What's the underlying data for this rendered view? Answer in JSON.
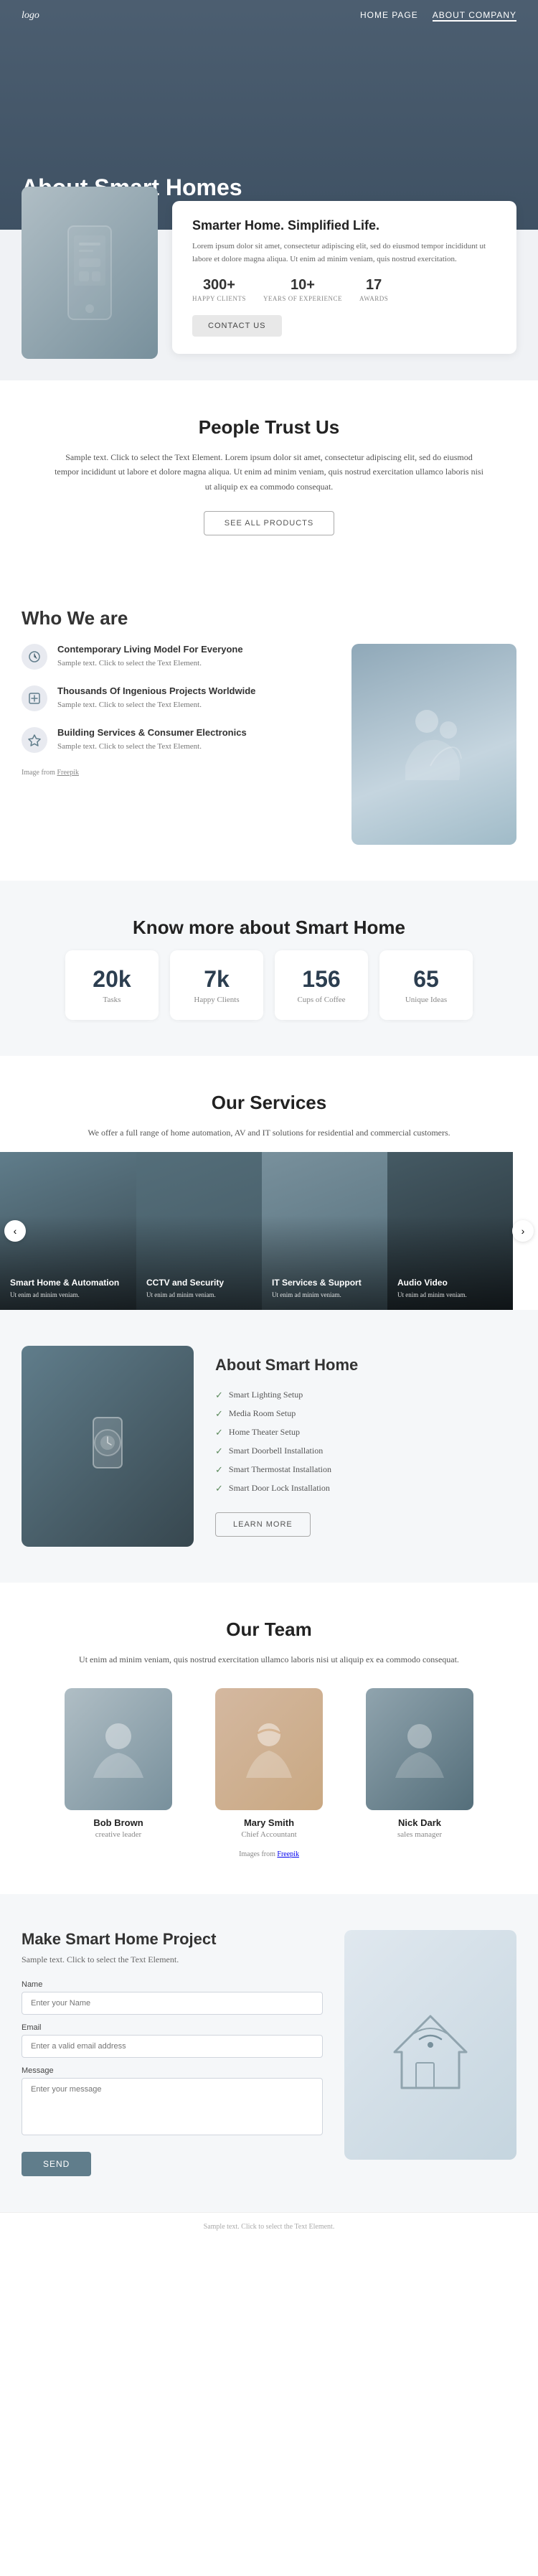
{
  "nav": {
    "logo": "logo",
    "links": [
      {
        "label": "HOME PAGE",
        "active": false
      },
      {
        "label": "ABOUT COMPANY",
        "active": true
      }
    ]
  },
  "hero": {
    "title": "About Smart Homes"
  },
  "hero_card": {
    "tagline": "Smarter Home. Simplified Life.",
    "description": "Lorem ipsum dolor sit amet, consectetur adipiscing elit, sed do eiusmod tempor incididunt ut labore et dolore magna aliqua. Ut enim ad minim veniam, quis nostrud exercitation.",
    "stats": [
      {
        "number": "300+",
        "label": "HAPPY CLIENTS"
      },
      {
        "number": "10+",
        "label": "YEARS OF EXPERIENCE"
      },
      {
        "number": "17",
        "label": "AWARDS"
      }
    ],
    "contact_button": "CONTACT US"
  },
  "people_trust": {
    "title": "People Trust Us",
    "text": "Sample text. Click to select the Text Element. Lorem ipsum dolor sit amet, consectetur adipiscing elit, sed do eiusmod tempor incididunt ut labore et dolore magna aliqua. Ut enim ad minim veniam, quis nostrud exercitation ullamco laboris nisi ut aliquip ex ea commodo consequat.",
    "button": "SEE ALL PRODUCTS"
  },
  "who_we_are": {
    "title": "Who We are",
    "items": [
      {
        "icon": "1",
        "title": "Contemporary Living Model For Everyone",
        "text": "Sample text. Click to select the Text Element."
      },
      {
        "icon": "2",
        "title": "Thousands Of Ingenious Projects Worldwide",
        "text": "Sample text. Click to select the Text Element."
      },
      {
        "icon": "3",
        "title": "Building Services & Consumer Electronics",
        "text": "Sample text. Click to select the Text Element."
      }
    ],
    "freepik_label": "Image from ",
    "freepik_link": "Freepik"
  },
  "know_more": {
    "title": "Know more about Smart Home",
    "stats": [
      {
        "number": "20k",
        "label": "Tasks"
      },
      {
        "number": "7k",
        "label": "Happy Clients"
      },
      {
        "number": "156",
        "label": "Cups of Coffee"
      },
      {
        "number": "65",
        "label": "Unique Ideas"
      }
    ]
  },
  "our_services": {
    "title": "Our Services",
    "text": "We offer a full range of home automation, AV and IT solutions for residential and commercial customers.",
    "cards": [
      {
        "title": "Smart Home & Automation",
        "text": "Ut enim ad minim veniam."
      },
      {
        "title": "CCTV and Security",
        "text": "Ut enim ad minim veniam."
      },
      {
        "title": "IT Services & Support",
        "text": "Ut enim ad minim veniam."
      },
      {
        "title": "Audio Video",
        "text": "Ut enim ad minim veniam."
      }
    ]
  },
  "about_smart": {
    "title": "About Smart Home",
    "list": [
      "Smart Lighting Setup",
      "Media Room Setup",
      "Home Theater Setup",
      "Smart Doorbell Installation",
      "Smart Thermostat Installation",
      "Smart Door Lock Installation"
    ],
    "button": "LEARN MORE"
  },
  "our_team": {
    "title": "Our Team",
    "text": "Ut enim ad minim veniam, quis nostrud exercitation ullamco laboris nisi ut aliquip ex ea commodo consequat.",
    "members": [
      {
        "name": "Bob Brown",
        "role": "creative leader",
        "photo_class": "brown"
      },
      {
        "name": "Mary Smith",
        "role": "Chief Accountant",
        "photo_class": "smith"
      },
      {
        "name": "Nick Dark",
        "role": "sales manager",
        "photo_class": "dark"
      }
    ],
    "freepik_label": "Images from ",
    "freepik_link": "Freepik"
  },
  "contact": {
    "title": "Make Smart Home Project",
    "desc": "Sample text. Click to select the Text Element.",
    "fields": {
      "name_label": "Name",
      "name_placeholder": "Enter your Name",
      "email_label": "Email",
      "email_placeholder": "Enter a valid email address",
      "message_label": "Message",
      "message_placeholder": "Enter your message"
    },
    "send_button": "SEND"
  },
  "footer": {
    "text": "Sample text. Click to select the Text Element."
  }
}
